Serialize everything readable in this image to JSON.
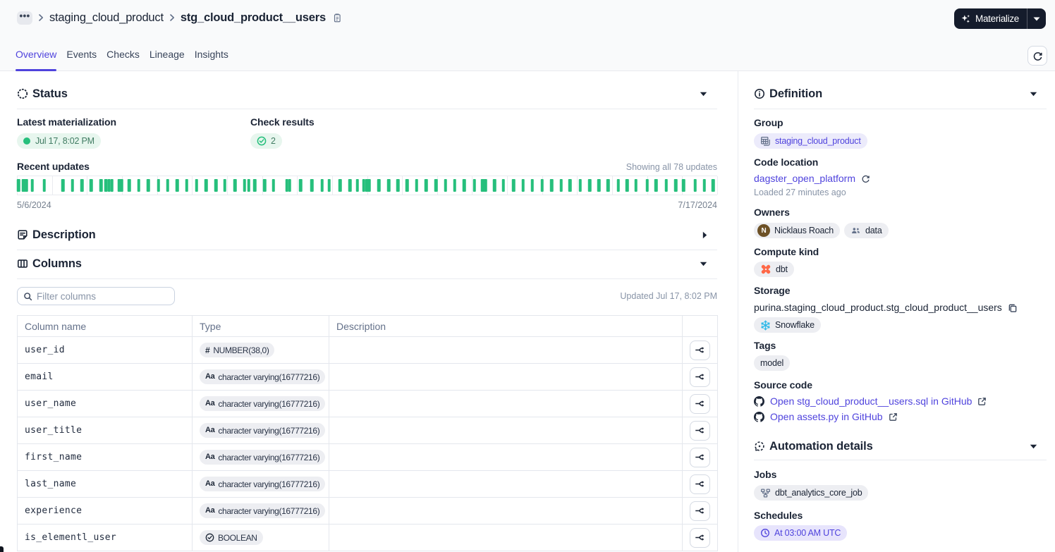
{
  "colors": {
    "accent": "#4F43DD",
    "ink": "#1B2435",
    "ink_soft": "#38445A",
    "slate": "#64718A",
    "muted": "#8894A7",
    "muted2": "#75808F",
    "green": "#26BF7C",
    "green_bg": "#E7F6EE",
    "green_text": "#417C63",
    "pill_bg": "#EDEEF2",
    "pill_lavender_bg": "#ECEBFB",
    "sched_bg": "#E7E4FC",
    "border": "#E8EAEF",
    "border_soft": "#E9EBF0",
    "table_border": "#E4E7ED",
    "input_border": "#C9D2E0",
    "btn_border": "#D5DAE3",
    "header_bg": "#F9FAFB",
    "btn_dark": "#151C2C",
    "dbt_orange": "#FF6847",
    "snowflake_blue": "#2FB9E8",
    "avatar_brown": "#6D5126"
  },
  "header": {
    "breadcrumb": {
      "ellipsis": "•••",
      "group": "staging_cloud_product",
      "asset": "stg_cloud_product__users"
    },
    "materialize_label": "Materialize",
    "tabs": [
      {
        "label": "Overview",
        "active": true
      },
      {
        "label": "Events",
        "active": false
      },
      {
        "label": "Checks",
        "active": false
      },
      {
        "label": "Lineage",
        "active": false
      },
      {
        "label": "Insights",
        "active": false
      }
    ]
  },
  "status": {
    "title": "Status",
    "latest_materialization_label": "Latest materialization",
    "latest_materialization_value": "Jul 17, 8:02 PM",
    "check_results_label": "Check results",
    "check_results_value": "2",
    "recent_updates_label": "Recent updates",
    "recent_updates_summary": "Showing all 78 updates",
    "start_date": "5/6/2024",
    "end_date": "7/17/2024",
    "chart_data": {
      "type": "bar",
      "description": "timeline of 78 materialization updates between 5/6/2024 and 7/17/2024; x positions in percent of strip width",
      "bar_positions_pct": [
        0.22,
        0.94,
        1.34,
        2.19,
        3.9,
        6.59,
        7.93,
        9.27,
        10.6,
        12.01,
        12.73,
        13.17,
        13.57,
        14.63,
        15.0,
        16.03,
        17.41,
        18.75,
        20.2,
        21.55,
        22.89,
        24.23,
        25.63,
        27.01,
        28.4,
        29.7,
        31.15,
        32.48,
        33.11,
        33.95,
        35.36,
        36.64,
        38.53,
        38.93,
        40.5,
        42.11,
        43.56,
        44.57,
        46.13,
        47.58,
        48.63,
        49.5,
        49.9,
        50.3,
        51.71,
        53.09,
        54.39,
        55.72,
        57.07,
        58.41,
        59.86,
        61.2,
        62.53,
        63.87,
        65.33,
        66.51,
        66.87,
        68.19,
        69.48,
        70.94,
        72.27,
        73.61,
        75.02,
        76.36,
        77.7,
        78.97,
        80.42,
        81.8,
        83.1,
        84.44,
        85.9,
        87.16,
        88.41,
        90.02,
        91.25,
        92.7,
        94.08,
        95.2,
        96.83,
        98.17,
        99.44
      ],
      "gridline_count": 20
    }
  },
  "description_section": {
    "title": "Description"
  },
  "columns_section": {
    "title": "Columns",
    "filter_placeholder": "Filter columns",
    "updated_text": "Updated Jul 17, 8:02 PM",
    "table": {
      "headers": {
        "name": "Column name",
        "type": "Type",
        "description": "Description"
      },
      "rows": [
        {
          "name": "user_id",
          "type": "NUMBER(38,0)",
          "kind": "number",
          "description": ""
        },
        {
          "name": "email",
          "type": "character varying(16777216)",
          "kind": "text",
          "description": ""
        },
        {
          "name": "user_name",
          "type": "character varying(16777216)",
          "kind": "text",
          "description": ""
        },
        {
          "name": "user_title",
          "type": "character varying(16777216)",
          "kind": "text",
          "description": ""
        },
        {
          "name": "first_name",
          "type": "character varying(16777216)",
          "kind": "text",
          "description": ""
        },
        {
          "name": "last_name",
          "type": "character varying(16777216)",
          "kind": "text",
          "description": ""
        },
        {
          "name": "experience",
          "type": "character varying(16777216)",
          "kind": "text",
          "description": ""
        },
        {
          "name": "is_elementl_user",
          "type": "BOOLEAN",
          "kind": "boolean",
          "description": ""
        }
      ]
    }
  },
  "definition": {
    "title": "Definition",
    "group_label": "Group",
    "group_value": "staging_cloud_product",
    "code_location_label": "Code location",
    "code_location_value": "dagster_open_platform",
    "code_location_loaded": "Loaded 27 minutes ago",
    "owners_label": "Owners",
    "owner_user": "Nicklaus Roach",
    "owner_user_initial": "N",
    "owner_team": "data",
    "compute_kind_label": "Compute kind",
    "compute_kind_value": "dbt",
    "storage_label": "Storage",
    "storage_path": "purina.staging_cloud_product.stg_cloud_product__users",
    "storage_platform": "Snowflake",
    "tags_label": "Tags",
    "tags": [
      "model"
    ],
    "source_code_label": "Source code",
    "source_links": [
      "Open stg_cloud_product__users.sql in GitHub",
      "Open assets.py in GitHub"
    ]
  },
  "automation": {
    "title": "Automation details",
    "jobs_label": "Jobs",
    "jobs_value": "dbt_analytics_core_job",
    "schedules_label": "Schedules",
    "schedules_value": "At 03:00 AM UTC"
  }
}
